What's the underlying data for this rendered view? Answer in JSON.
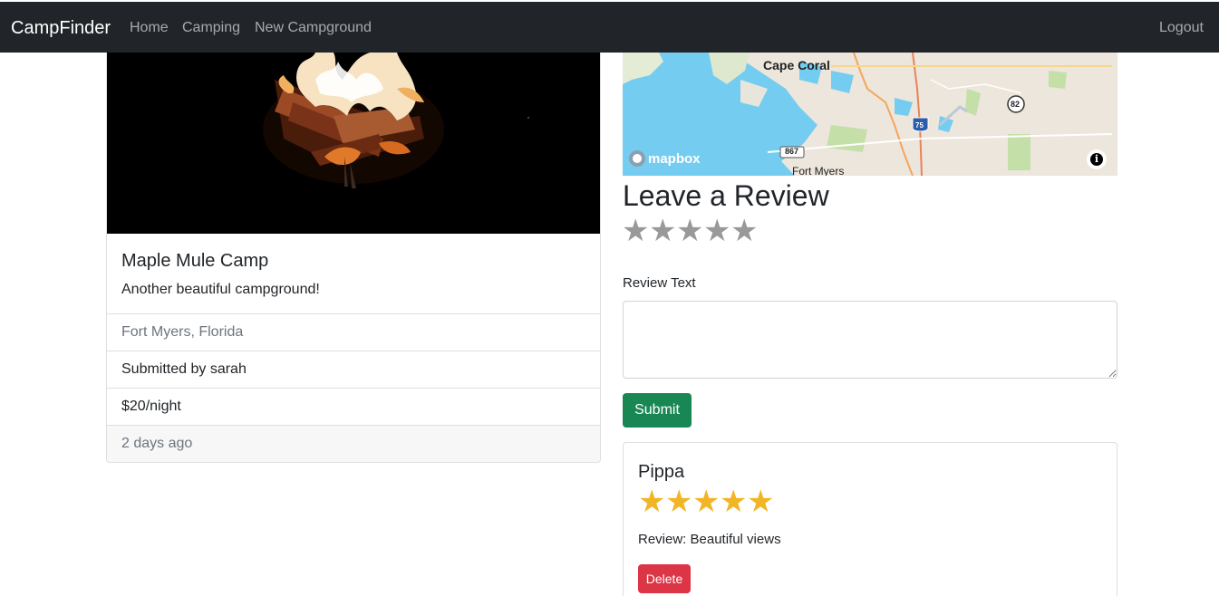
{
  "navbar": {
    "brand": "CampFinder",
    "links": [
      "Home",
      "Camping",
      "New Campground"
    ],
    "logout": "Logout"
  },
  "campground": {
    "title": "Maple Mule Camp",
    "description": "Another beautiful campground!",
    "location": "Fort Myers, Florida",
    "submitted_by": "Submitted by sarah",
    "price": "$20/night",
    "posted": "2 days ago"
  },
  "map": {
    "labels": {
      "cape_coral": "Cape Coral",
      "fort_myers": "Fort Myers",
      "hwy_867": "867",
      "hwy_82": "82",
      "hwy_75": "75"
    },
    "attribution": "mapbox",
    "info_glyph": "i"
  },
  "review_form": {
    "title": "Leave a Review",
    "rating": 0,
    "text_label": "Review Text",
    "text_value": "",
    "submit_label": "Submit"
  },
  "reviews": [
    {
      "author": "Pippa",
      "rating": 5,
      "text": "Review: Beautiful views",
      "delete_label": "Delete"
    }
  ],
  "colors": {
    "navbar": "#212529",
    "submit": "#198754",
    "delete": "#dc3545",
    "star_filled": "#f2b525",
    "star_empty": "#999999"
  },
  "icons": {
    "rating_star": "star-icon",
    "map_info": "info-icon",
    "map_logo": "mapbox-logo"
  }
}
